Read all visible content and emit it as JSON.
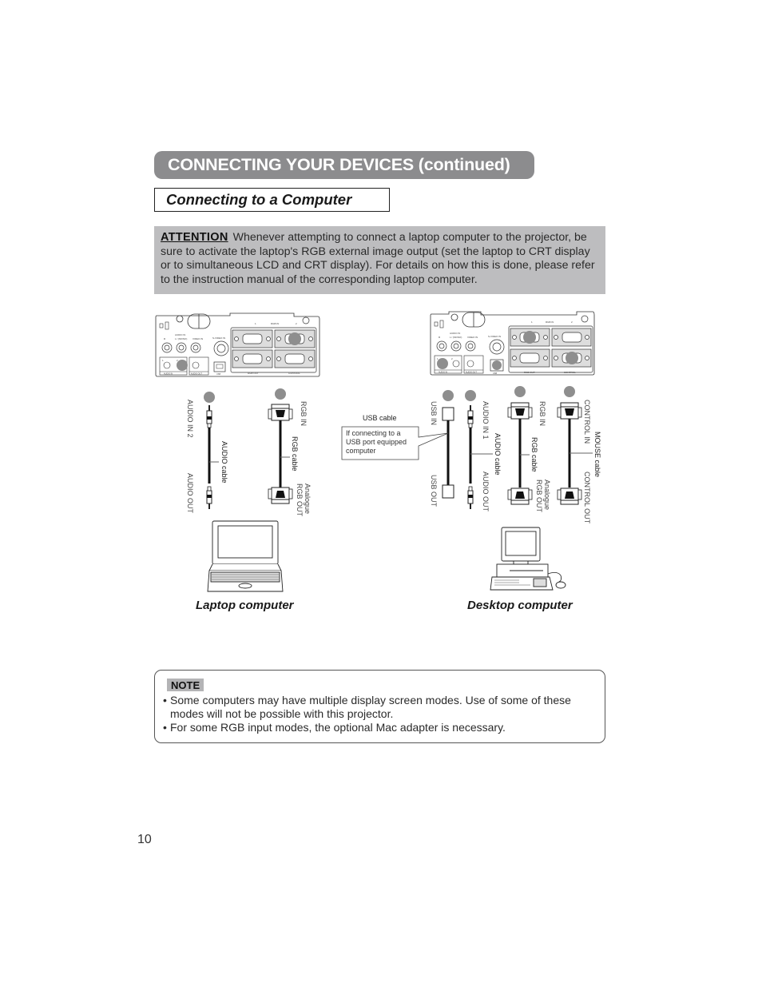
{
  "header": {
    "section_title": "CONNECTING YOUR DEVICES (continued)",
    "subsection_title": "Connecting to a Computer"
  },
  "attention": {
    "label": "ATTENTION",
    "text": "Whenever attempting to connect a laptop computer to the projector, be sure to activate the laptop's RGB external image output (set the laptop to CRT display or to simultaneous LCD and CRT display). For details on how this is done, please refer to the instruction manual of the corresponding laptop computer."
  },
  "projector_panel": {
    "labels": {
      "audio_in": "AUDIO IN",
      "r": "R",
      "l_mono": "L / (MONO)",
      "video_in": "VIDEO IN",
      "s_video_in": "S-VIDEO IN",
      "rgb_in": "RGB IN",
      "rgb_in_1": "1",
      "rgb_in_2": "2",
      "rgb_out": "RGB OUT",
      "control": "CONTROL",
      "audio_in_bottom": "AUDIO IN",
      "audio_out": "AUDIO OUT",
      "usb": "USB",
      "port_1": "1",
      "port_2": "2"
    }
  },
  "laptop_diagram": {
    "caption": "Laptop computer",
    "cables": [
      {
        "name": "AUDIO cable",
        "end_projector": "AUDIO IN 2",
        "end_computer": "AUDIO OUT"
      },
      {
        "name": "RGB cable",
        "end_projector": "RGB IN",
        "end_computer": "Analogue RGB OUT",
        "end_computer_line1": "Analogue",
        "end_computer_line2": "RGB OUT"
      }
    ]
  },
  "desktop_diagram": {
    "caption": "Desktop computer",
    "usb_callout": {
      "title": "USB cable",
      "text_line1": "If connecting to a",
      "text_line2": "USB port equipped",
      "text_line3": "computer"
    },
    "cables": [
      {
        "name": "USB cable",
        "end_projector": "USB IN",
        "end_computer": "USB OUT"
      },
      {
        "name": "AUDIO cable",
        "end_projector": "AUDIO IN 1",
        "end_computer": "AUDIO OUT"
      },
      {
        "name": "RGB cable",
        "end_projector": "RGB IN",
        "end_computer": "Analogue RGB OUT",
        "end_computer_line1": "Analogue",
        "end_computer_line2": "RGB OUT"
      },
      {
        "name": "MOUSE cable",
        "end_projector": "CONTROL IN",
        "end_computer": "CONTROL OUT"
      }
    ]
  },
  "note": {
    "label": "NOTE",
    "items": [
      "Some computers may have multiple display screen modes. Use of some of these modes will not be possible with this projector.",
      "For some RGB input modes, the optional Mac adapter is necessary."
    ]
  },
  "page_number": "10",
  "colors": {
    "banner_gray": "#8c8c8e",
    "attention_gray": "#bdbdbf",
    "note_badge_gray": "#b4b4b6",
    "port_marker_gray": "#8e8e8e"
  }
}
